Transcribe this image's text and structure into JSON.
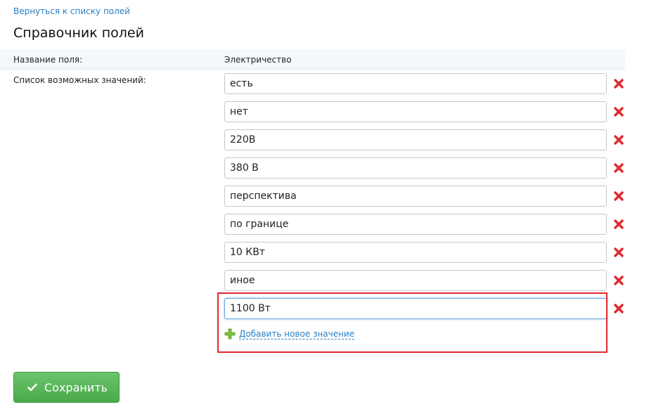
{
  "nav": {
    "back_link": "Вернуться к списку полей"
  },
  "page": {
    "title": "Справочник полей"
  },
  "form": {
    "field_name_label": "Название поля:",
    "field_name_value": "Электричество",
    "values_label": "Список возможных значений:",
    "values": [
      {
        "value": "есть"
      },
      {
        "value": "нет"
      },
      {
        "value": "220В"
      },
      {
        "value": "380 В"
      },
      {
        "value": "перспектива"
      },
      {
        "value": "по границе"
      },
      {
        "value": "10 КВт"
      },
      {
        "value": "иное"
      },
      {
        "value": "1100 Вт",
        "focused": true
      }
    ],
    "add_value_link": "Добавить новое значение",
    "save_button": "Сохранить"
  },
  "icons": {
    "delete": "close-icon",
    "add": "plus-icon",
    "save": "checkmark-icon"
  },
  "colors": {
    "link": "#2a7fc7",
    "delete_red": "#e0282d",
    "save_green": "#52b052",
    "highlight_border": "#e0282d"
  }
}
